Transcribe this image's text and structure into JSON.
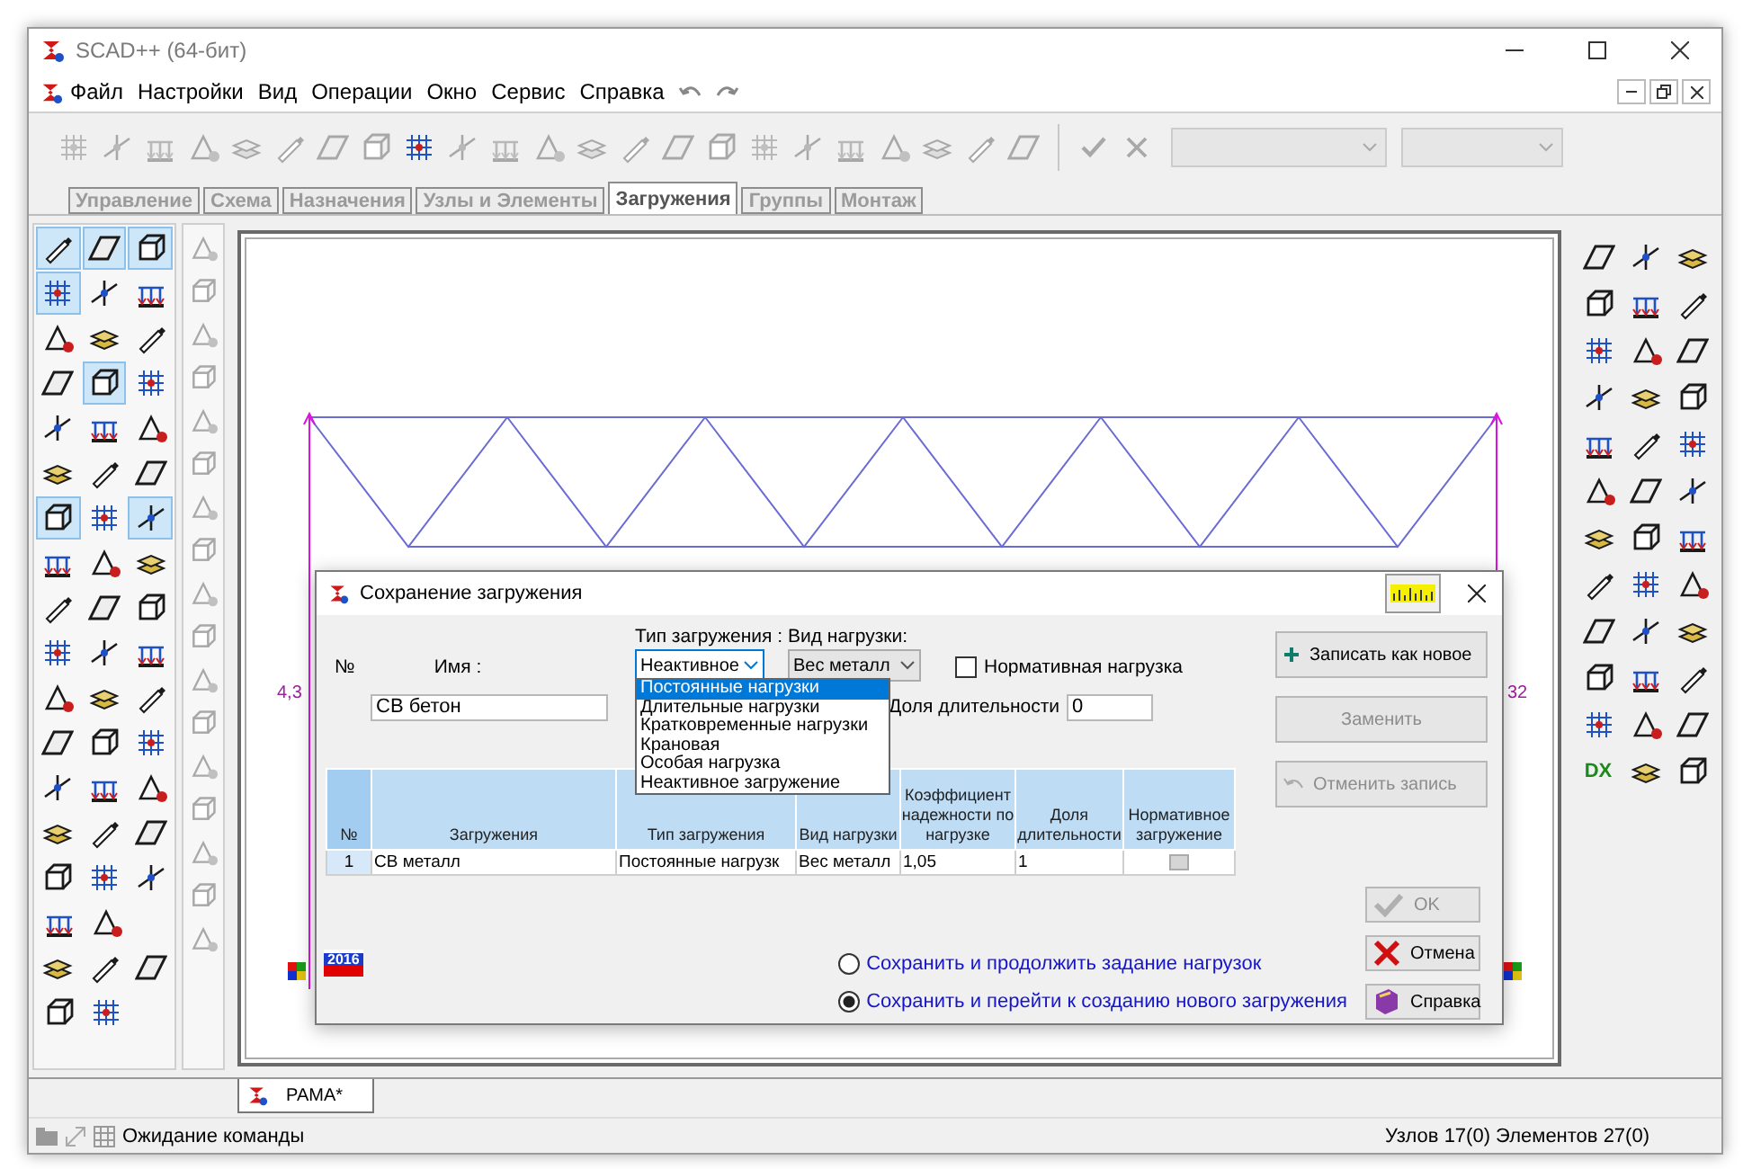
{
  "window": {
    "title": "SCAD++ (64-бит)"
  },
  "menu": [
    "Файл",
    "Настройки",
    "Вид",
    "Операции",
    "Окно",
    "Сервис",
    "Справка"
  ],
  "toolbar": {
    "tools": [
      {
        "disabled": true
      },
      {
        "disabled": true
      },
      {
        "disabled": true
      },
      {
        "disabled": true
      },
      {
        "disabled": true
      },
      {
        "disabled": true
      },
      {
        "disabled": true
      },
      {
        "disabled": true
      },
      {
        "disabled": false
      },
      {
        "disabled": true
      },
      {
        "disabled": true
      },
      {
        "disabled": true
      },
      {
        "disabled": true
      },
      {
        "disabled": true
      },
      {
        "disabled": true
      },
      {
        "disabled": true
      },
      {
        "disabled": true
      },
      {
        "disabled": true
      },
      {
        "disabled": true
      },
      {
        "disabled": true
      },
      {
        "disabled": true
      },
      {
        "disabled": true
      },
      {
        "disabled": true
      }
    ],
    "actions": [
      {
        "kind": "check",
        "disabled": true
      },
      {
        "kind": "cross",
        "disabled": true
      }
    ],
    "dropdowns": [
      {
        "disabled": true
      },
      {
        "disabled": true
      }
    ]
  },
  "tabs": [
    {
      "label": "Управление",
      "selected": false
    },
    {
      "label": "Схема",
      "selected": false
    },
    {
      "label": "Назначения",
      "selected": false
    },
    {
      "label": "Узлы и Элементы",
      "selected": false
    },
    {
      "label": "Загружения",
      "selected": true
    },
    {
      "label": "Группы",
      "selected": false
    },
    {
      "label": "Монтаж",
      "selected": false
    }
  ],
  "left_palette": {
    "rows": [
      [
        {
          "selected": true
        },
        {
          "selected": true
        },
        {
          "selected": true
        }
      ],
      [
        {
          "selected": true
        },
        {
          "selected": false
        },
        {
          "selected": false
        }
      ],
      [
        {
          "selected": false
        },
        {
          "selected": false
        },
        {
          "selected": false
        }
      ],
      [
        {
          "selected": false
        },
        {
          "selected": true
        },
        {
          "selected": false
        }
      ],
      [
        {
          "selected": false
        },
        {
          "selected": false
        },
        {
          "selected": false
        }
      ],
      [
        {
          "selected": false
        },
        {
          "selected": false
        },
        {
          "selected": false
        }
      ],
      [
        {
          "selected": true
        },
        {
          "selected": false
        },
        {
          "selected": true
        }
      ],
      [
        {
          "selected": false
        },
        {
          "selected": false
        },
        {
          "selected": false
        }
      ],
      [
        {
          "selected": false
        },
        {
          "selected": false
        },
        {
          "selected": false
        }
      ],
      [
        {
          "selected": false
        },
        {
          "selected": false
        },
        {
          "selected": false
        }
      ],
      [
        {
          "selected": false
        },
        {
          "selected": false
        },
        {
          "selected": false
        }
      ],
      [
        {
          "selected": false
        },
        {
          "selected": false
        },
        {
          "selected": false
        }
      ],
      [
        {
          "selected": false
        },
        {
          "selected": false
        },
        {
          "selected": false
        }
      ],
      [
        {
          "selected": false
        },
        {
          "selected": false
        },
        {
          "selected": false
        }
      ],
      [
        {
          "selected": false
        },
        {
          "selected": false
        },
        {
          "selected": false
        }
      ],
      [
        {
          "selected": false
        },
        {
          "selected": false
        }
      ],
      [
        {
          "selected": false
        },
        {
          "selected": false
        },
        {
          "selected": false
        }
      ],
      [
        {
          "selected": false
        },
        {
          "selected": false
        }
      ]
    ],
    "secondary_tools": [
      {
        "disabled": true
      },
      {
        "disabled": true
      },
      {
        "disabled": true
      },
      {
        "disabled": true
      },
      {
        "disabled": true
      },
      {
        "disabled": true
      },
      {
        "disabled": true
      },
      {
        "disabled": true
      },
      {
        "disabled": true
      },
      {
        "disabled": true
      },
      {
        "disabled": true
      },
      {
        "disabled": true
      },
      {
        "disabled": true
      },
      {
        "disabled": true
      },
      {
        "disabled": true
      },
      {
        "disabled": true
      },
      {
        "disabled": true
      }
    ]
  },
  "canvas": {
    "labels": [
      "4,3",
      "32"
    ]
  },
  "right_palette": {
    "tools": [
      {
        "kind": "icon"
      },
      {
        "kind": "icon"
      },
      {
        "kind": "icon"
      },
      {
        "kind": "icon"
      },
      {
        "kind": "icon"
      },
      {
        "kind": "icon"
      },
      {
        "kind": "icon"
      },
      {
        "kind": "icon"
      },
      {
        "kind": "icon"
      },
      {
        "kind": "icon"
      },
      {
        "kind": "icon"
      },
      {
        "kind": "icon"
      },
      {
        "kind": "icon"
      },
      {
        "kind": "icon"
      },
      {
        "kind": "icon"
      },
      {
        "kind": "icon"
      },
      {
        "kind": "icon"
      },
      {
        "kind": "icon"
      },
      {
        "kind": "icon"
      },
      {
        "kind": "icon"
      },
      {
        "kind": "icon"
      },
      {
        "kind": "icon"
      },
      {
        "kind": "icon"
      },
      {
        "kind": "icon"
      },
      {
        "kind": "icon"
      },
      {
        "kind": "icon"
      },
      {
        "kind": "icon"
      },
      {
        "kind": "icon"
      },
      {
        "kind": "icon"
      },
      {
        "kind": "icon"
      },
      {
        "kind": "icon"
      },
      {
        "kind": "icon"
      },
      {
        "kind": "icon"
      },
      {
        "kind": "text",
        "label": "DX"
      },
      {
        "kind": "icon"
      },
      {
        "kind": "icon"
      }
    ]
  },
  "dialog": {
    "title": "Сохранение загружения",
    "number_label": "№",
    "name_label": "Имя :",
    "name_value": "СВ бетон",
    "load_type": {
      "label": "Тип загружения :",
      "value": "Неактивное",
      "expanded": true,
      "options": [
        {
          "label": "Постоянные нагрузки",
          "selected": true
        },
        {
          "label": "Длительные нагрузки",
          "selected": false
        },
        {
          "label": "Кратковременные нагрузки",
          "selected": false
        },
        {
          "label": "Крановая",
          "selected": false
        },
        {
          "label": "Особая нагрузка",
          "selected": false
        },
        {
          "label": "Неактивное загружение",
          "selected": false
        }
      ]
    },
    "load_kind": {
      "label": "Вид нагрузки:",
      "value": "Вес металл"
    },
    "normative": {
      "label": "Нормативная нагрузка",
      "checked": false
    },
    "duration": {
      "label": "Доля длительности",
      "value": "0"
    },
    "table": {
      "columns": [
        "№",
        "Загружения",
        "Тип загружения",
        "Вид нагрузки",
        "Коэффициент надежности по нагрузке",
        "Доля длительности",
        "Нормативное загружение"
      ],
      "rows": [
        {
          "cells": [
            "1",
            "СВ металл",
            "Постоянные нагрузк",
            "Вес металл",
            "1,05",
            "1"
          ],
          "normative": false
        }
      ]
    },
    "side_buttons": [
      {
        "label": "Записать как новое",
        "kind": "add",
        "disabled": false
      },
      {
        "label": "Заменить",
        "kind": "plain",
        "disabled": true
      },
      {
        "label": "Отменить запись",
        "kind": "undo",
        "disabled": true
      }
    ],
    "badge": "2016",
    "save_options": [
      {
        "label": "Сохранить и продолжить задание нагрузок",
        "selected": false
      },
      {
        "label": "Сохранить и перейти к созданию нового загружения",
        "selected": true
      }
    ],
    "bottom_buttons": [
      {
        "label": "OK",
        "kind": "ok",
        "disabled": true
      },
      {
        "label": "Отмена",
        "kind": "cancel",
        "disabled": false
      },
      {
        "label": "Справка",
        "kind": "help",
        "disabled": false
      }
    ]
  },
  "document_tabs": [
    {
      "label": "РАМА*",
      "selected": true
    }
  ],
  "status_bar": {
    "message": "Ожидание команды",
    "counts": "Узлов 17(0) Элементов 27(0)"
  }
}
